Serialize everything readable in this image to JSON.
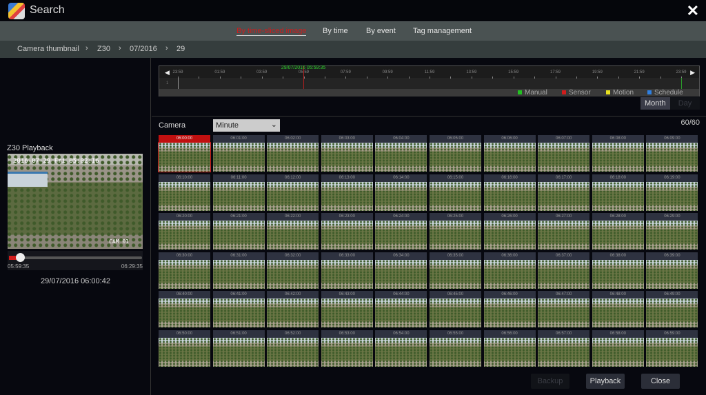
{
  "window": {
    "title": "Search",
    "icon": "search-app-icon",
    "close_icon": "close-icon"
  },
  "tabs": [
    {
      "label": "By time-sliced image",
      "active": true
    },
    {
      "label": "By time"
    },
    {
      "label": "By event"
    },
    {
      "label": "Tag management"
    }
  ],
  "breadcrumb": [
    "Camera thumbnail",
    "Z30",
    "07/2016",
    "29"
  ],
  "playback": {
    "title": "Z30 Playback",
    "overlay_time": "2016-07-29 Fri 05:02:16",
    "overlay_cam": "CAM 01",
    "start": "05:59:35",
    "end": "06:29:35",
    "progress_percent": 4,
    "current": "29/07/2016 06:00:42"
  },
  "timeline": {
    "cursor_label": "29/07/2016 05:59:35",
    "track_label": "1",
    "labels": [
      "23:59",
      "01:59",
      "03:59",
      "05:59",
      "07:59",
      "09:59",
      "11:59",
      "13:59",
      "15:59",
      "17:59",
      "19:59",
      "21:59",
      "23:59"
    ],
    "legend": [
      {
        "label": "Manual",
        "color": "#22c022"
      },
      {
        "label": "Sensor",
        "color": "#d01c1c"
      },
      {
        "label": "Motion",
        "color": "#e8e020"
      },
      {
        "label": "Schedule",
        "color": "#2f7fe0"
      }
    ]
  },
  "view_toggle": {
    "month": "Month",
    "day": "Day"
  },
  "camera": {
    "label": "Camera",
    "value": "Minute"
  },
  "count": "60/60",
  "thumbnails": [
    "06:00:00",
    "06:01:00",
    "06:02:00",
    "06:03:00",
    "06:04:00",
    "06:05:00",
    "06:06:00",
    "06:07:00",
    "06:08:00",
    "06:09:00",
    "06:10:00",
    "06:11:00",
    "06:12:00",
    "06:13:00",
    "06:14:00",
    "06:15:00",
    "06:16:00",
    "06:17:00",
    "06:18:00",
    "06:19:00",
    "06:20:00",
    "06:21:00",
    "06:22:00",
    "06:23:00",
    "06:24:00",
    "06:25:00",
    "06:26:00",
    "06:27:00",
    "06:28:00",
    "06:29:00",
    "06:30:00",
    "06:31:00",
    "06:32:00",
    "06:33:00",
    "06:34:00",
    "06:35:00",
    "06:36:00",
    "06:37:00",
    "06:38:00",
    "06:39:00",
    "06:40:00",
    "06:41:00",
    "06:42:00",
    "06:43:00",
    "06:44:00",
    "06:45:00",
    "06:46:00",
    "06:47:00",
    "06:48:00",
    "06:49:00",
    "06:50:00",
    "06:51:00",
    "06:52:00",
    "06:53:00",
    "06:54:00",
    "06:55:00",
    "06:56:00",
    "06:57:00",
    "06:58:00",
    "06:59:00"
  ],
  "selected_thumbnail": "06:00:00",
  "buttons": {
    "backup": "Backup",
    "playback": "Playback",
    "close": "Close"
  }
}
